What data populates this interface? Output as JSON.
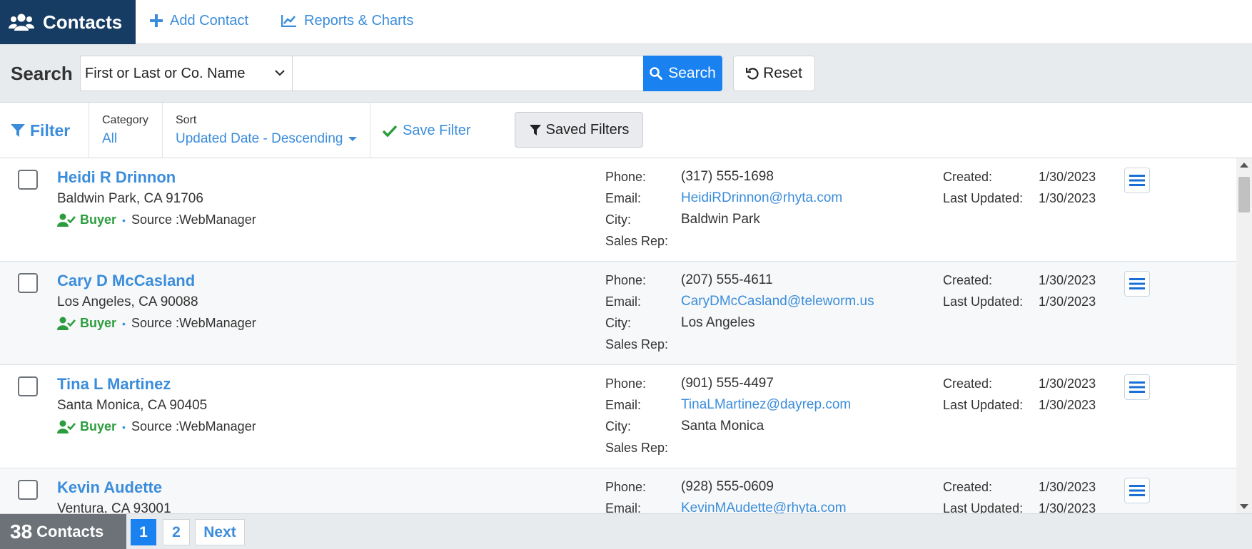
{
  "nav": {
    "brand": "Contacts",
    "add_contact": "Add Contact",
    "reports": "Reports & Charts"
  },
  "search": {
    "label": "Search",
    "field_selected": "First or Last or Co. Name",
    "query": "",
    "placeholder": "",
    "button": "Search",
    "reset": "Reset"
  },
  "filter": {
    "label": "Filter",
    "category_label": "Category",
    "category_value": "All",
    "sort_label": "Sort",
    "sort_value": "Updated Date - Descending",
    "save_filter": "Save Filter",
    "saved_filters": "Saved Filters"
  },
  "field_labels": {
    "phone": "Phone:",
    "email": "Email:",
    "city": "City:",
    "sales_rep": "Sales Rep:",
    "created": "Created:",
    "last_updated": "Last Updated:"
  },
  "contacts": [
    {
      "name": "Heidi R Drinnon",
      "address": "Baldwin Park, CA 91706",
      "type": "Buyer",
      "source": "Source :WebManager",
      "phone": "(317) 555-1698",
      "email": "HeidiRDrinnon@rhyta.com",
      "city": "Baldwin Park",
      "sales_rep": "",
      "created": "1/30/2023",
      "last_updated": "1/30/2023"
    },
    {
      "name": "Cary D McCasland",
      "address": "Los Angeles, CA 90088",
      "type": "Buyer",
      "source": "Source :WebManager",
      "phone": "(207) 555-4611",
      "email": "CaryDMcCasland@teleworm.us",
      "city": "Los Angeles",
      "sales_rep": "",
      "created": "1/30/2023",
      "last_updated": "1/30/2023"
    },
    {
      "name": "Tina L Martinez",
      "address": "Santa Monica, CA 90405",
      "type": "Buyer",
      "source": "Source :WebManager",
      "phone": "(901) 555-4497",
      "email": "TinaLMartinez@dayrep.com",
      "city": "Santa Monica",
      "sales_rep": "",
      "created": "1/30/2023",
      "last_updated": "1/30/2023"
    },
    {
      "name": "Kevin Audette",
      "address": "Ventura, CA 93001",
      "phone": "(928) 555-0609",
      "email": "KevinMAudette@rhyta.com",
      "created": "1/30/2023",
      "last_updated": "1/30/2023"
    }
  ],
  "footer": {
    "count": "38",
    "count_label": "Contacts",
    "pages": [
      "1",
      "2"
    ],
    "next": "Next"
  },
  "colors": {
    "brand_bg": "#173c64",
    "link": "#3b8ddb",
    "primary_button": "#1a82f0",
    "buyer_green": "#2c9d3e",
    "count_bg": "#6c7278"
  }
}
